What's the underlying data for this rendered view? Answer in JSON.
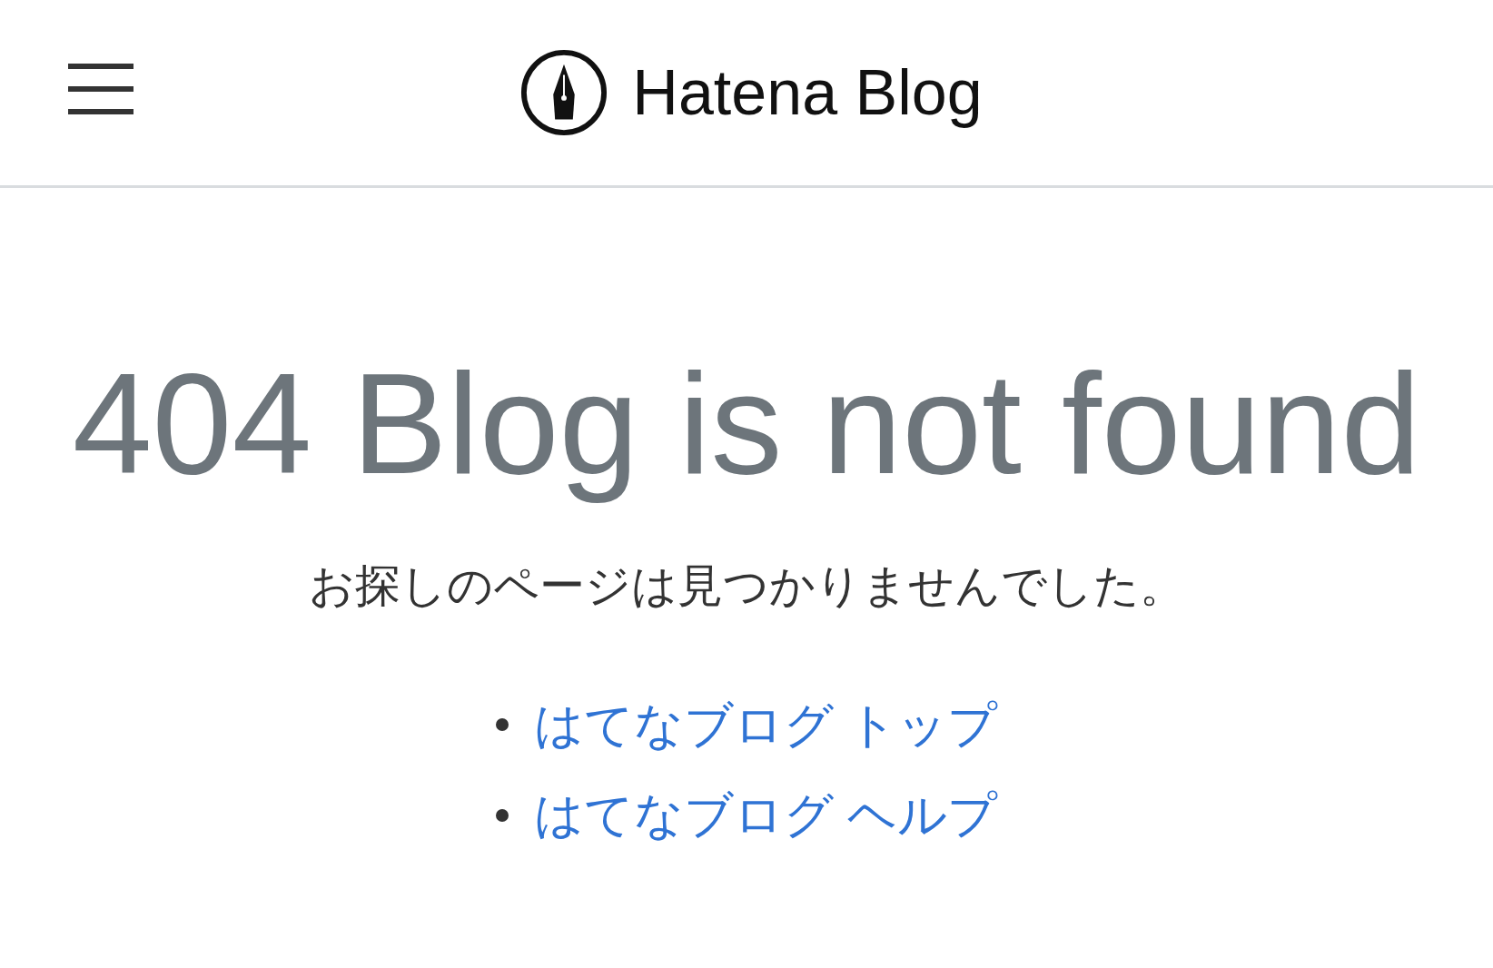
{
  "header": {
    "logo_text": "Hatena Blog"
  },
  "title": "404 Blog is not found",
  "message": "お探しのページは見つかりませんでした。",
  "links": [
    {
      "label": "はてなブログ トップ"
    },
    {
      "label": "はてなブログ ヘルプ"
    }
  ]
}
